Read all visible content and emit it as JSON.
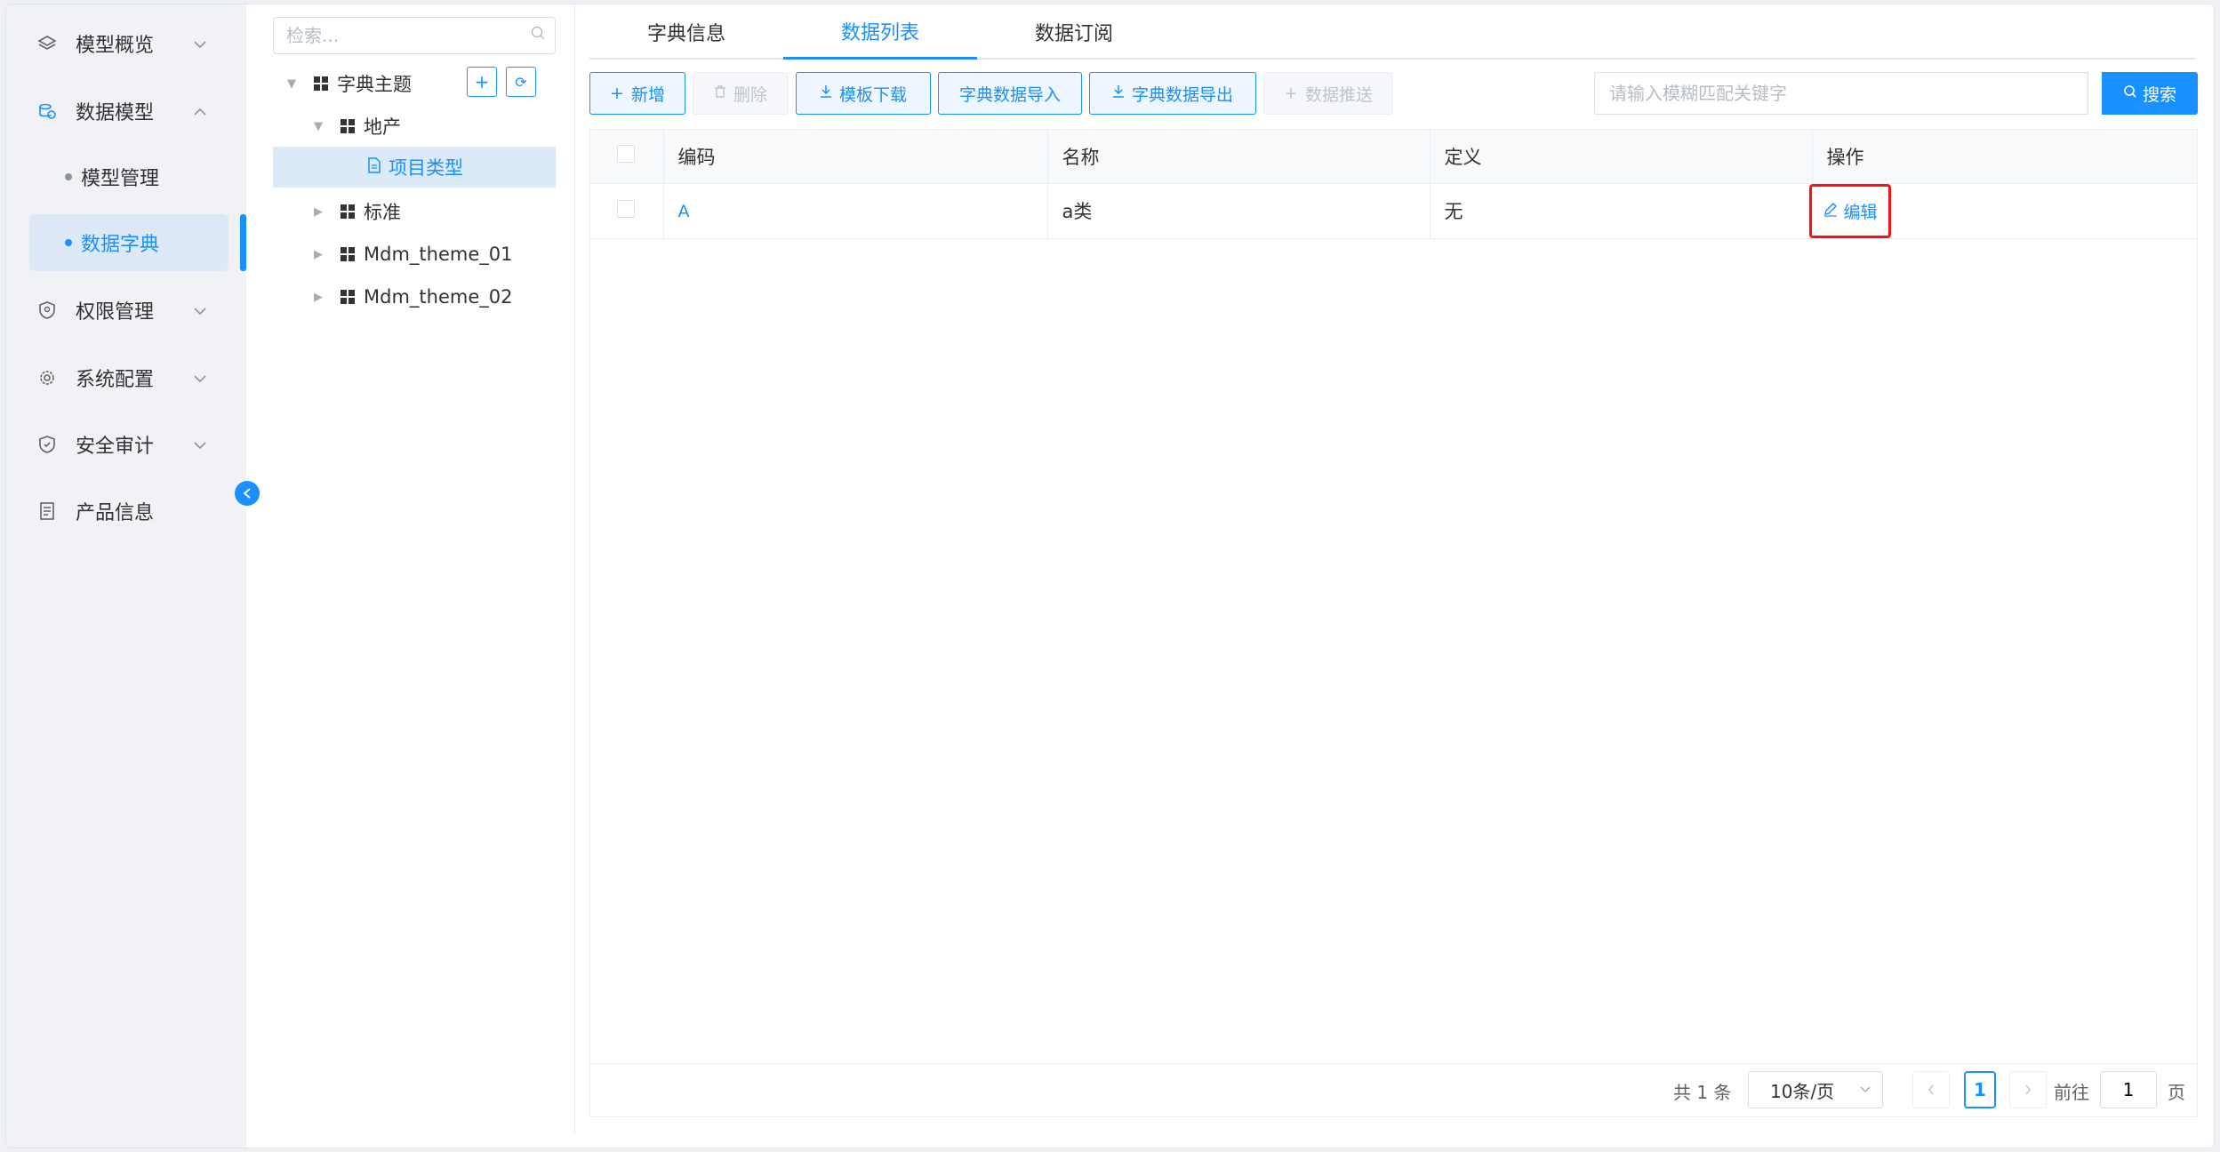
{
  "sidebar": {
    "items": [
      {
        "label": "模型概览",
        "icon": "layers-icon",
        "chevron": "⌄"
      },
      {
        "label": "数据模型",
        "icon": "database-model-icon",
        "chevron": "⌃"
      },
      {
        "label": "权限管理",
        "icon": "shield-icon",
        "chevron": "⌄"
      },
      {
        "label": "系统配置",
        "icon": "gear-icon",
        "chevron": "⌄"
      },
      {
        "label": "安全审计",
        "icon": "audit-shield-icon",
        "chevron": "⌄"
      },
      {
        "label": "产品信息",
        "icon": "document-icon",
        "chevron": ""
      }
    ],
    "sub_items": [
      {
        "label": "模型管理",
        "active": false
      },
      {
        "label": "数据字典",
        "active": true
      }
    ],
    "accent": "#1890ff"
  },
  "tree": {
    "search_placeholder": "检索...",
    "root": {
      "label": "字典主题"
    },
    "nodes": [
      {
        "label": "地产"
      },
      {
        "label": "项目类型",
        "selected": true
      },
      {
        "label": "标准"
      },
      {
        "label": "Mdm_theme_01"
      },
      {
        "label": "Mdm_theme_02"
      }
    ],
    "add_button": "+",
    "refresh_button": "⟳"
  },
  "tabs": [
    {
      "label": "字典信息",
      "active": false
    },
    {
      "label": "数据列表",
      "active": true
    },
    {
      "label": "数据订阅",
      "active": false
    }
  ],
  "toolbar": {
    "add": "新增",
    "delete": "删除",
    "template_download": "模板下载",
    "dict_import": "字典数据导入",
    "dict_export": "字典数据导出",
    "data_push": "数据推送",
    "search_placeholder": "请输入模糊匹配关键字",
    "search_button": "搜索"
  },
  "table": {
    "columns": [
      "编码",
      "名称",
      "定义",
      "操作"
    ],
    "rows": [
      {
        "code": "A",
        "name": "a类",
        "definition": "无",
        "action": "编辑"
      }
    ]
  },
  "pagination": {
    "total_text": "共 1 条",
    "page_size": "10条/页",
    "current_page": "1",
    "goto_label": "前往",
    "goto_value": "1",
    "page_unit": "页"
  },
  "colors": {
    "primary": "#1890ff",
    "highlight_border": "#ff1010"
  }
}
